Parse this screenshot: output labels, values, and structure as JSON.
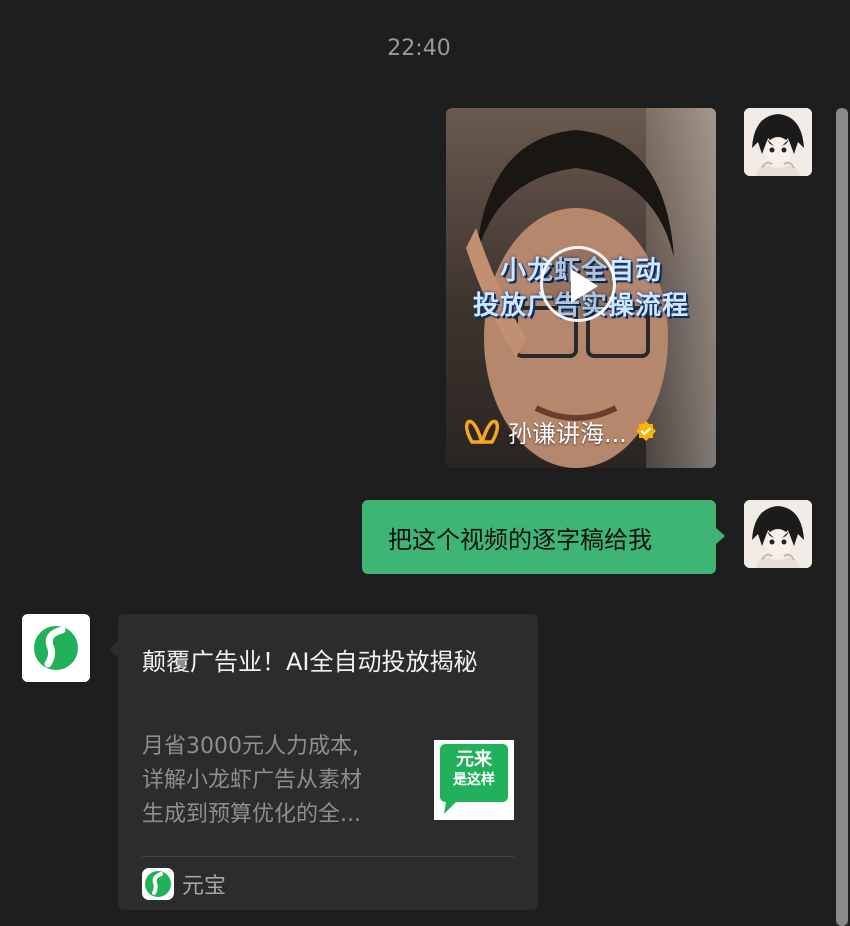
{
  "chat": {
    "timestamp": "22:40",
    "video_message": {
      "overlay_title_line1": "小龙虾全自动",
      "overlay_title_line2": "投放广告实操流程",
      "channel_name": "孙谦讲海...",
      "channel_icon": "channels-butterfly-icon",
      "verified_icon": "verified-badge-icon",
      "accent_color": "#f5a623"
    },
    "user_message": {
      "text": "把这个视频的逐字稿给我"
    },
    "bot_card": {
      "title": "颠覆广告业！AI全自动投放揭秘",
      "description_line1": "月省3000元人力成本,",
      "description_line2": "详解小龙虾广告从素材",
      "description_line3": "生成到预算优化的全...",
      "thumb_text_line1": "元来",
      "thumb_text_line2": "是这样",
      "source_name": "元宝"
    },
    "colors": {
      "background": "#1e1e1e",
      "user_bubble": "#3eb574",
      "bot_card": "#2c2c2c",
      "brand_green": "#20b15a"
    }
  }
}
